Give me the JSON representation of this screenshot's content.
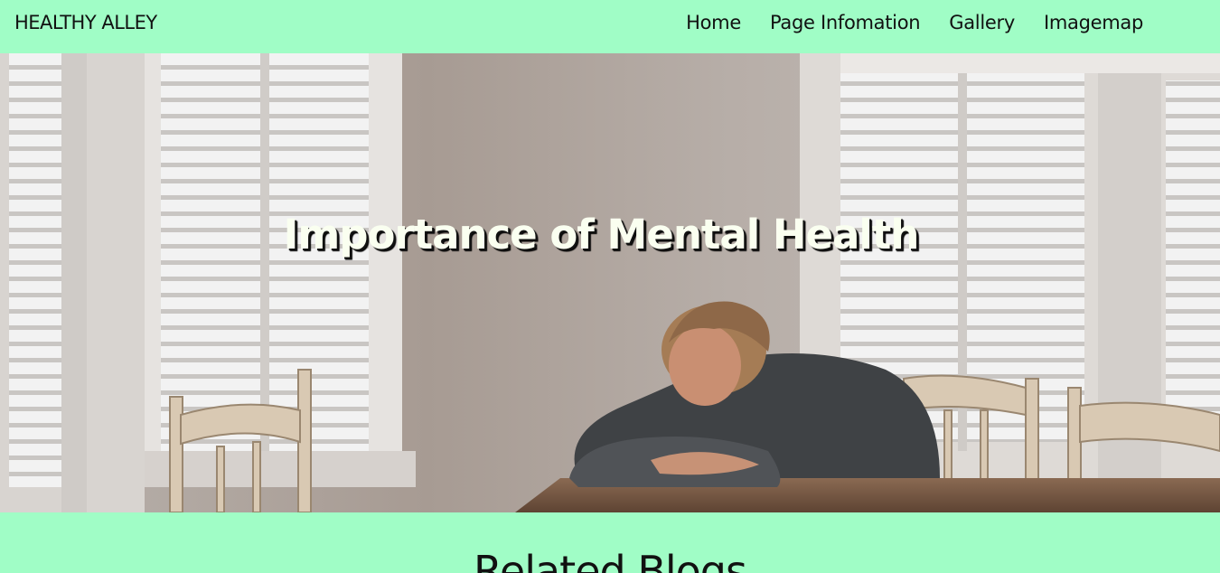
{
  "nav": {
    "brand": "HEALTHY ALLEY",
    "links": [
      {
        "label": "Home"
      },
      {
        "label": "Page Infomation"
      },
      {
        "label": "Gallery"
      },
      {
        "label": "Imagemap"
      }
    ]
  },
  "hero": {
    "title": "Importance of Mental Health",
    "image_description_icon": "photo-person-head-on-table"
  },
  "related": {
    "title": "Related Blogs"
  },
  "colors": {
    "nav_bg": "#a0fdc6",
    "text": "#111111",
    "hero_title": "#fafff0"
  }
}
